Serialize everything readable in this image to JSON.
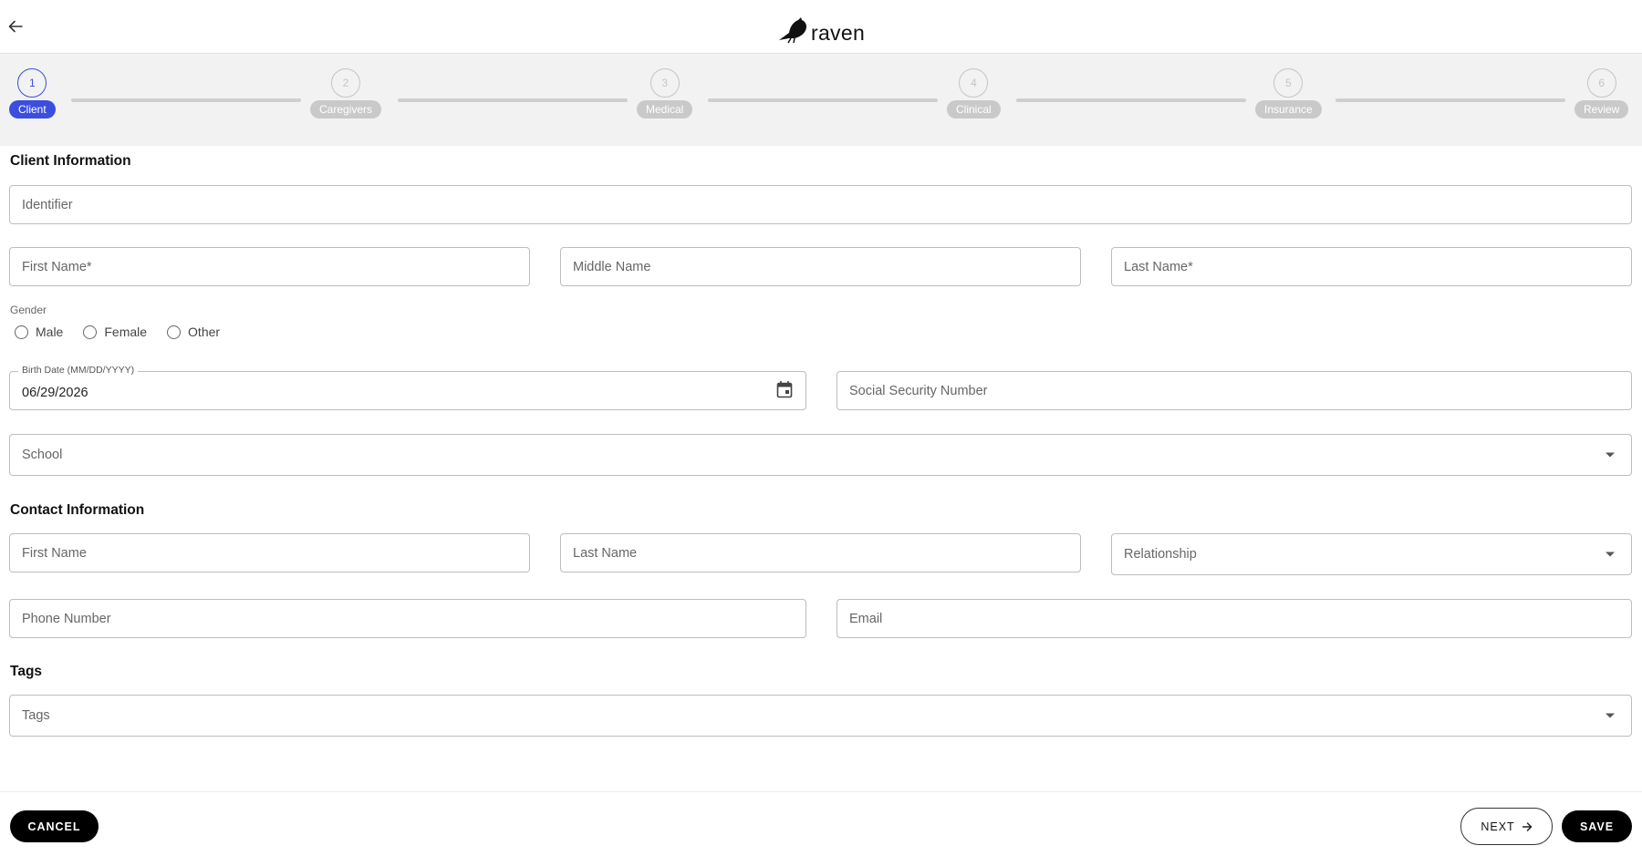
{
  "header": {
    "logo_text": "raven"
  },
  "stepper": {
    "steps": [
      {
        "number": "1",
        "label": "Client"
      },
      {
        "number": "2",
        "label": "Caregivers"
      },
      {
        "number": "3",
        "label": "Medical"
      },
      {
        "number": "4",
        "label": "Clinical"
      },
      {
        "number": "5",
        "label": "Insurance"
      },
      {
        "number": "6",
        "label": "Review"
      }
    ],
    "active_step": 1
  },
  "client_info": {
    "title": "Client Information",
    "identifier_placeholder": "Identifier",
    "first_name_placeholder": "First Name*",
    "middle_name_placeholder": "Middle Name",
    "last_name_placeholder": "Last Name*",
    "gender_label": "Gender",
    "gender_options": [
      "Male",
      "Female",
      "Other"
    ],
    "birth_date_label": "Birth Date (MM/DD/YYYY)",
    "birth_date_value": "06/29/2026",
    "ssn_placeholder": "Social Security Number",
    "school_placeholder": "School"
  },
  "contact_info": {
    "title": "Contact Information",
    "first_name_placeholder": "First Name",
    "last_name_placeholder": "Last Name",
    "relationship_placeholder": "Relationship",
    "phone_placeholder": "Phone Number",
    "email_placeholder": "Email"
  },
  "tags": {
    "title": "Tags",
    "placeholder": "Tags"
  },
  "footer": {
    "cancel_label": "CANCEL",
    "next_label": "NEXT",
    "save_label": "SAVE"
  },
  "colors": {
    "accent": "#3b4ee0",
    "inactive_step": "#c9c9c9",
    "stepper_bg": "#f2f2f2",
    "button_dark": "#000000"
  }
}
